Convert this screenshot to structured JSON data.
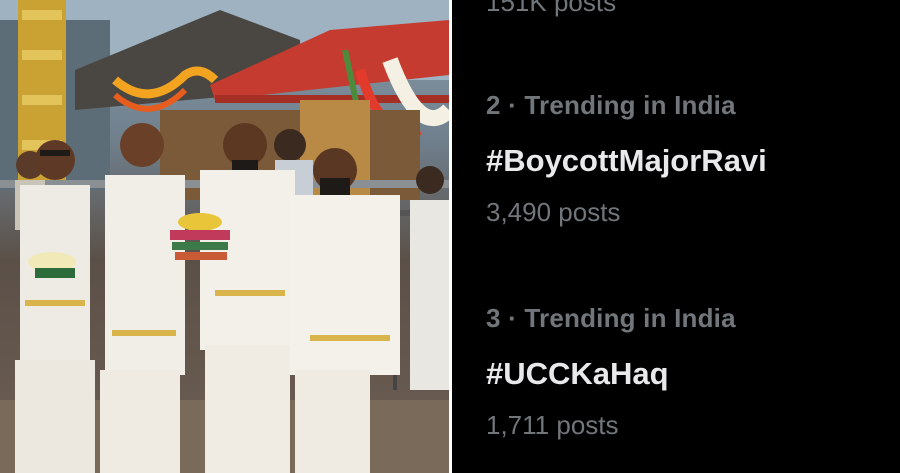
{
  "photo": {
    "description_label": ""
  },
  "trends": {
    "previous_post_count": "151K posts",
    "items": [
      {
        "rank_label": "2 · Trending in India",
        "hashtag": "#BoycottMajorRavi",
        "post_count": "3,490 posts"
      },
      {
        "rank_label": "3 · Trending in India",
        "hashtag": "#UCCKaHaq",
        "post_count": "1,711 posts"
      }
    ]
  },
  "colors": {
    "panel_background": "#000000",
    "primary_text": "#e7e9ea",
    "secondary_text": "#71767b"
  }
}
